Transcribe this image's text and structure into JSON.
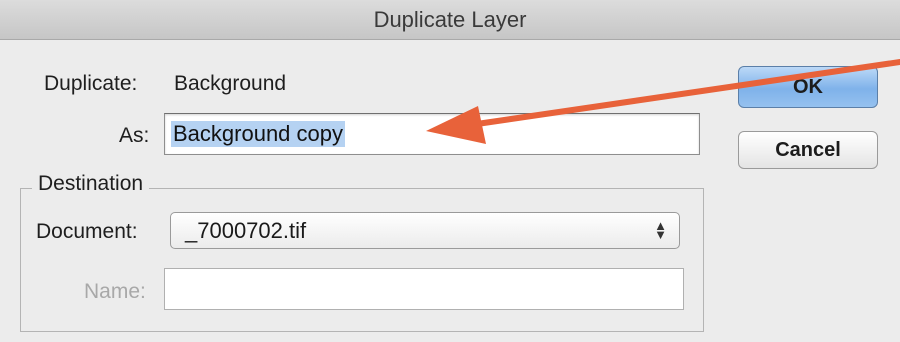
{
  "window": {
    "title": "Duplicate Layer"
  },
  "duplicate": {
    "label": "Duplicate:",
    "value": "Background"
  },
  "as_field": {
    "label": "As:",
    "value": "Background copy"
  },
  "buttons": {
    "ok": "OK",
    "cancel": "Cancel"
  },
  "destination": {
    "group_title": "Destination",
    "document_label": "Document:",
    "document_value": "_7000702.tif",
    "name_label": "Name:",
    "name_value": ""
  },
  "annotation": {
    "arrow_color": "#e8623a"
  },
  "colors": {
    "ok_button": "#8fbcef",
    "selection": "#b5d2f2"
  }
}
